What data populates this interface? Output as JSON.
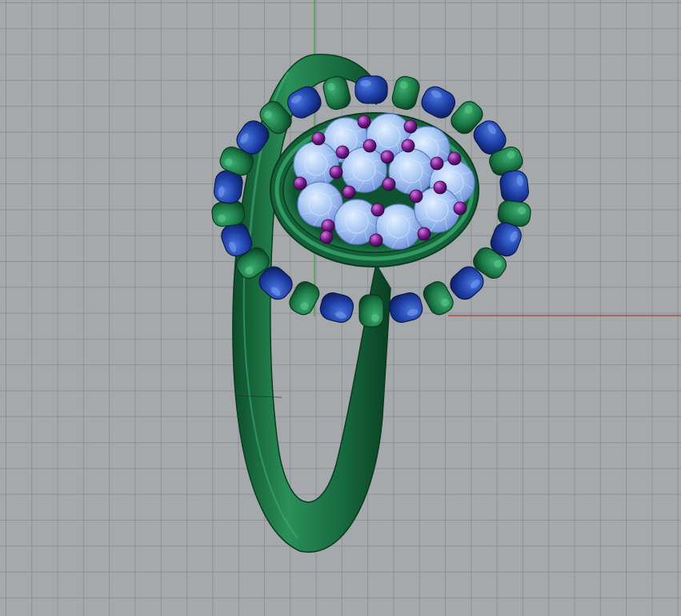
{
  "viewport": {
    "background": "#a5a9ac",
    "grid_color": "#7a7e82",
    "axis_x_color": "#b23a3a",
    "axis_y_color": "#3aa43a"
  },
  "model": {
    "metal_color": "#1f7a4a",
    "metal_shadow": "#0c4a2a",
    "bead_color": "#1c3ea8",
    "gem_color": "#9ec4f2",
    "prong_color": "#7a1a8e"
  }
}
